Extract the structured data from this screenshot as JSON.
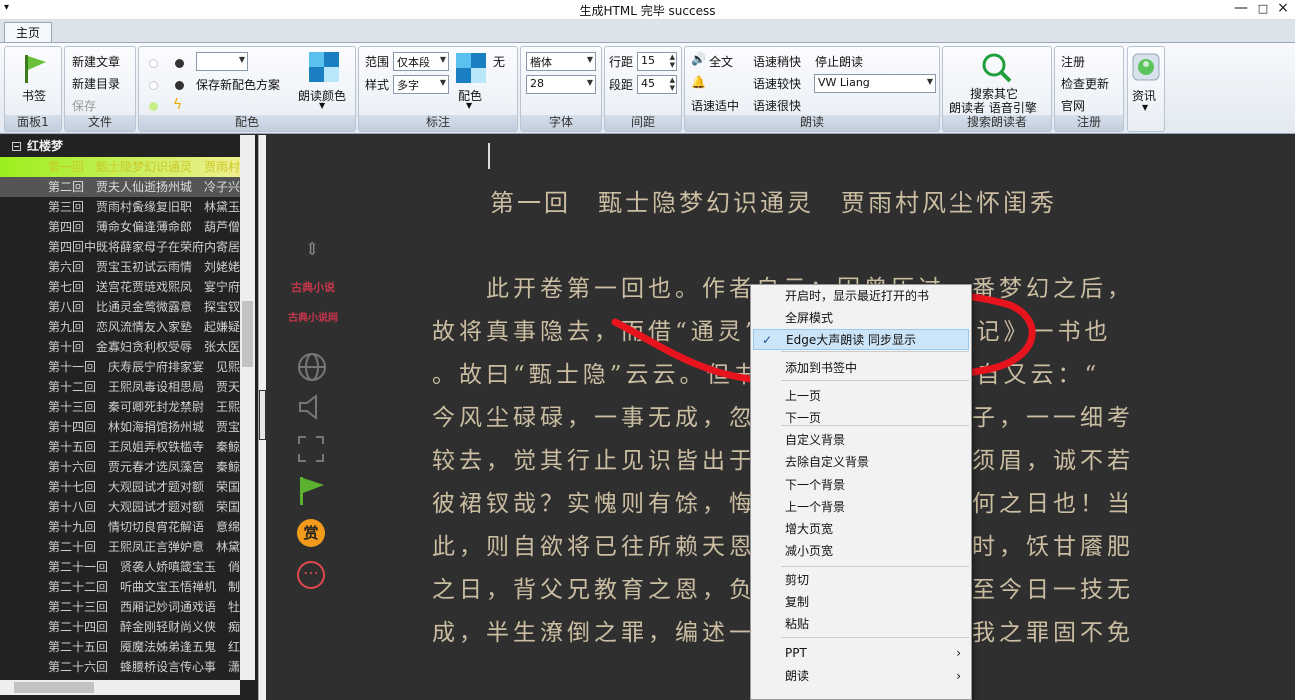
{
  "window": {
    "title": "生成HTML 完毕 success",
    "menu_glyph": "▾",
    "min": "—",
    "max": "□",
    "close": "×"
  },
  "tabs": [
    {
      "label": "主页"
    }
  ],
  "ribbon": {
    "panel1": {
      "bookmark": "书签",
      "caption": "面板1"
    },
    "file": {
      "new_article": "新建文章",
      "new_dir": "新建目录",
      "save": "保存",
      "caption": "文件"
    },
    "color": {
      "save_scheme": "保存新配色方案",
      "read_color": "朗读颜色",
      "caption": "配色"
    },
    "annot": {
      "range_label": "范围",
      "range_value": "仅本段",
      "style_label": "样式",
      "style_value": "多字",
      "none": "无",
      "color": "配色",
      "caption": "标注"
    },
    "font": {
      "family": "楷体",
      "size": "28",
      "caption": "字体"
    },
    "spacing": {
      "line_label": "行距",
      "line_value": "15",
      "para_label": "段距",
      "para_value": "45",
      "caption": "间距"
    },
    "read": {
      "full": "全文",
      "slow": "语速稍快",
      "stop": "停止朗读",
      "faster": "语速较快",
      "voice": "VW Liang",
      "medium": "语速适中",
      "fastest": "语速很快",
      "caption": "朗读"
    },
    "search": {
      "line1": "搜索其它",
      "line2": "朗读者 语音引擎",
      "caption": "搜索朗读者"
    },
    "register": {
      "register": "注册",
      "update": "检查更新",
      "site": "官网",
      "caption": "注册"
    },
    "info": {
      "label": "资讯"
    }
  },
  "sidebar": {
    "book": "红楼梦",
    "chapters": [
      "第一回　甄士隐梦幻识通灵　贾雨村",
      "第二回　贾夫人仙逝扬州城　冷子兴",
      "第三回　贾雨村夤缘复旧职　林黛玉",
      "第四回　薄命女偏逢薄命郎　葫芦僧",
      "第四回中既将薛家母子在荣府内寄居",
      "第六回　贾宝玉初试云雨情　刘姥姥",
      "第七回　送宫花贾琏戏熙凤　宴宁府",
      "第八回　比通灵金莺微露意　探宝钗",
      "第九回　恋风流情友入家塾　起嫌疑",
      "第十回　金寡妇贪利权受辱　张太医",
      "第十一回　庆寿辰宁府排家宴　见熙",
      "第十二回　王熙凤毒设相思局　贾天",
      "第十三回　秦可卿死封龙禁尉　王熙",
      "第十四回　林如海捐馆扬州城　贾宝",
      "第十五回　王凤姐弄权铁槛寺　秦鲸",
      "第十六回　贾元春才选凤藻宫　秦鲸",
      "第十七回　大观园试才题对额　荣国",
      "第十八回　大观园试才题对额　荣国",
      "第十九回　情切切良宵花解语　意绵",
      "第二十回　王熙凤正言弹妒意　林黛",
      "第二十一回　贤袭人娇嗔箴宝玉　俏",
      "第二十二回　听曲文宝玉悟禅机　制",
      "第二十三回　西厢记妙词通戏语　牡",
      "第二十四回　醉金刚轻财尚义侠　痴",
      "第二十五回　魇魔法姊弟逢五鬼　红",
      "第二十六回　蜂腰桥设言传心事　潇"
    ]
  },
  "reader": {
    "title": "第一回　甄士隐梦幻识通灵　贾雨村风尘怀闺秀",
    "lines": [
      "　　此开卷第一回也。作者自云：因曾历过一番梦幻之后，",
      "故将真事隐去，而借“通灵”之说，撰此《石头记》一书也",
      "。故曰“甄士隐”云云。但书中所记何事何人？自又云：“",
      "今风尘碌碌，一事无成，忽念及当日所有之女子，一一细考",
      "较去，觉其行止见识皆出于我之上。何我堂堂须眉，诚不若",
      "彼裙钗哉？实愧则有馀，悔又无益之大无可如何之日也！当",
      "此，则自欲将已往所赖天恩祖德，锦衣纨绔之时，饫甘餍肥",
      "之日，背父兄教育之恩，负师友规谈之德，以至今日一技无",
      "成，半生潦倒之罪，编述一集，以告天下人：我之罪固不免"
    ],
    "logo_line1": "古典小说",
    "logo_line2": "古典小说网",
    "reward": "赏"
  },
  "context_menu": {
    "items": [
      {
        "label": "开启时，显示最近打开的书"
      },
      {
        "label": "全屏模式"
      },
      {
        "label": "Edge大声朗读 同步显示",
        "checked": true
      },
      {
        "label": "添加到书签中"
      },
      {
        "label": "上一页"
      },
      {
        "label": "下一页"
      },
      {
        "label": "自定义背景"
      },
      {
        "label": "去除自定义背景"
      },
      {
        "label": "下一个背景"
      },
      {
        "label": "上一个背景"
      },
      {
        "label": "增大页宽"
      },
      {
        "label": "减小页宽"
      },
      {
        "label": "剪切"
      },
      {
        "label": "复制"
      },
      {
        "label": "粘贴"
      },
      {
        "label": "PPT",
        "submenu": true
      },
      {
        "label": "朗读",
        "submenu": true
      }
    ],
    "check_glyph": "✓",
    "submenu_glyph": "›"
  },
  "colors": {
    "accent_green": "#5cb22f",
    "annotation_red": "#e8141d",
    "reader_bg": "#2f2f2f",
    "reader_text": "#cbbda2",
    "highlight": "#9bef1d"
  }
}
